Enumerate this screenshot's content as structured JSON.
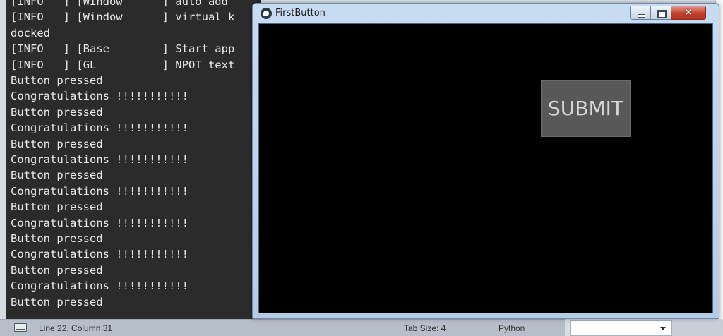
{
  "terminal": {
    "lines": [
      "[INFO   ] [Window      ] auto add",
      "[INFO   ] [Window      ] virtual k",
      "docked",
      "[INFO   ] [Base        ] Start app",
      "[INFO   ] [GL          ] NPOT text",
      "Button pressed",
      "Congratulations !!!!!!!!!!!",
      "Button pressed",
      "Congratulations !!!!!!!!!!!",
      "Button pressed",
      "Congratulations !!!!!!!!!!!",
      "Button pressed",
      "Congratulations !!!!!!!!!!!",
      "Button pressed",
      "Congratulations !!!!!!!!!!!",
      "Button pressed",
      "Congratulations !!!!!!!!!!!",
      "Button pressed",
      "Congratulations !!!!!!!!!!!",
      "Button pressed"
    ]
  },
  "window": {
    "title": "FirstButton",
    "icon": "kivy-app-icon",
    "close_glyph": "✕",
    "submit_label": "SUBMIT"
  },
  "statusbar": {
    "position": "Line 22, Column 31",
    "tab_size": "Tab Size: 4",
    "syntax": "Python"
  },
  "colors": {
    "terminal_bg": "#2b2b2b",
    "terminal_text": "#e8e8e8",
    "canvas_bg": "#000000",
    "button_bg": "#585858",
    "button_text": "#d6d6d6",
    "close_button": "#c2402d"
  }
}
